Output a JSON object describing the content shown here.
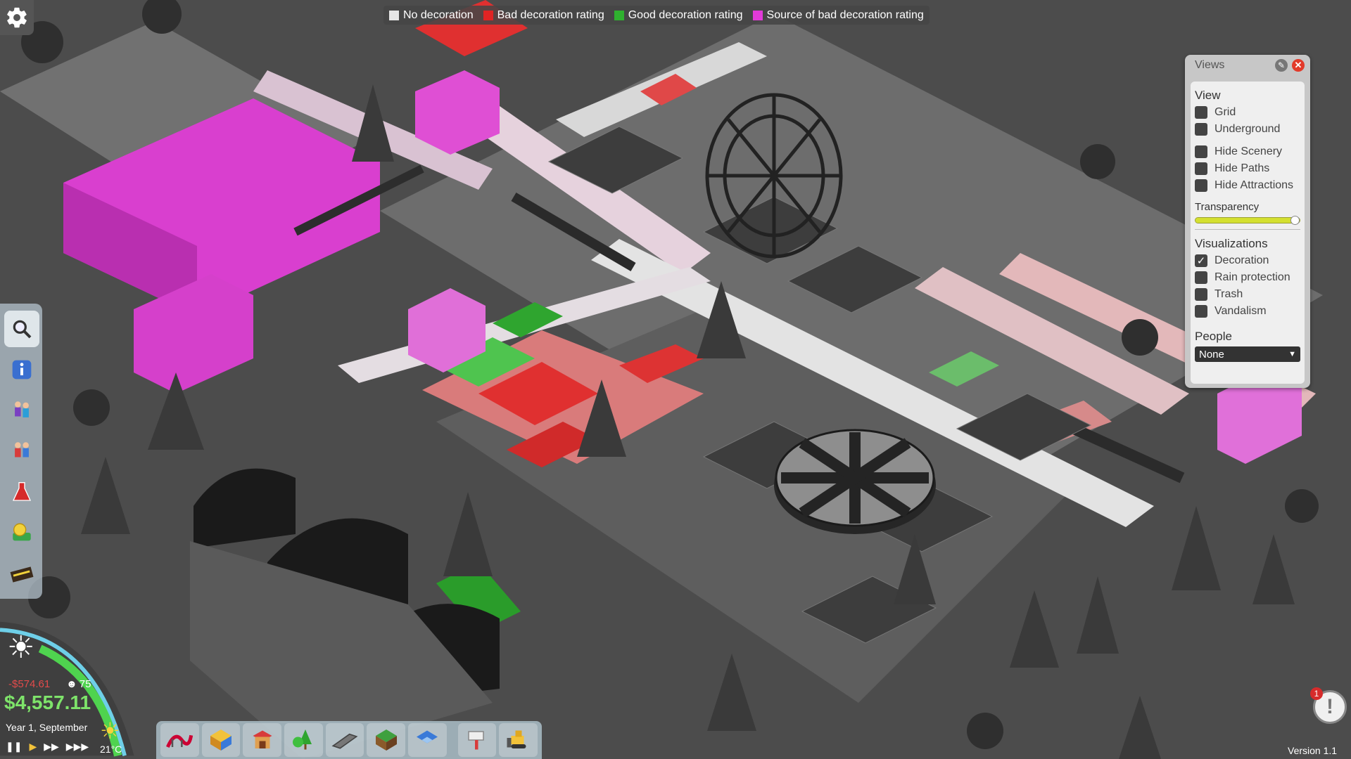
{
  "legend": {
    "items": [
      {
        "label": "No decoration",
        "color": "#e6e6e6"
      },
      {
        "label": "Bad decoration rating",
        "color": "#e02424"
      },
      {
        "label": "Good decoration rating",
        "color": "#2fb12f"
      },
      {
        "label": "Source of bad decoration rating",
        "color": "#e23ad8"
      }
    ]
  },
  "views_panel": {
    "title": "Views",
    "view_section": "View",
    "view_options": [
      {
        "label": "Grid",
        "checked": false
      },
      {
        "label": "Underground",
        "checked": false
      },
      {
        "label": "Hide Scenery",
        "checked": false
      },
      {
        "label": "Hide Paths",
        "checked": false
      },
      {
        "label": "Hide Attractions",
        "checked": false
      }
    ],
    "transparency_label": "Transparency",
    "transparency_value": 1.0,
    "visualizations_section": "Visualizations",
    "visualization_options": [
      {
        "label": "Decoration",
        "checked": true
      },
      {
        "label": "Rain protection",
        "checked": false
      },
      {
        "label": "Trash",
        "checked": false
      },
      {
        "label": "Vandalism",
        "checked": false
      }
    ],
    "people_section": "People",
    "people_selected": "None"
  },
  "status": {
    "money_delta": "-$574.61",
    "guest_count": "75",
    "money_total": "$4,557.11",
    "date": "Year 1, September",
    "temperature": "21°C"
  },
  "left_toolbar": {
    "icons": [
      "search-icon",
      "info-icon",
      "guests-icon",
      "staff-icon",
      "research-icon",
      "finances-icon",
      "park-management-icon"
    ]
  },
  "build_toolbar": {
    "icons": [
      "coaster-icon",
      "flat-ride-icon",
      "shop-icon",
      "scenery-icon",
      "path-icon",
      "building-icon",
      "blueprint-icon",
      "paint-icon",
      "bulldozer-icon"
    ]
  },
  "alert": {
    "badge": "1"
  },
  "version": "Version 1.1"
}
